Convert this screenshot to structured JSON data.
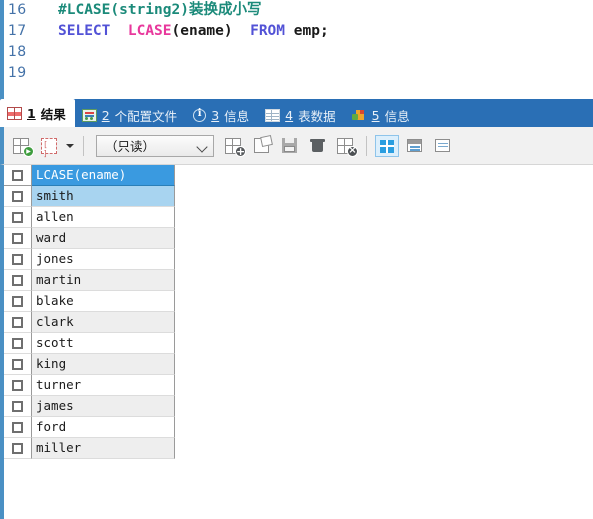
{
  "editor": {
    "lines": [
      {
        "number": "16",
        "tokens": [
          {
            "text": "#LCASE(string2)",
            "type": "comment"
          },
          {
            "text": "装换成小写",
            "type": "cjk"
          }
        ]
      },
      {
        "number": "17",
        "tokens": [
          {
            "text": "SELECT ",
            "type": "kw"
          },
          {
            "text": " LCASE",
            "type": "fn"
          },
          {
            "text": "(ename) ",
            "type": "plain"
          },
          {
            "text": " FROM ",
            "type": "kw"
          },
          {
            "text": "emp;",
            "type": "plain"
          }
        ]
      },
      {
        "number": "18",
        "tokens": []
      },
      {
        "number": "19",
        "tokens": []
      }
    ],
    "line_16_number": "16",
    "line_17_number": "17",
    "line_18_number": "18",
    "line_19_number": "19",
    "line_16_comment": "#LCASE(string2)",
    "line_16_cjk": "装换成小写",
    "kw_select": "SELECT",
    "fn_lcase": "LCASE",
    "arg_ename": "(ename)",
    "kw_from": "FROM",
    "tbl_emp": "emp;"
  },
  "tabs": [
    {
      "num": "1",
      "label": "结果",
      "icon": "results-grid-icon",
      "active": true
    },
    {
      "num": "2",
      "label": "个配置文件",
      "icon": "profile-icon",
      "active": false
    },
    {
      "num": "3",
      "label": "信息",
      "icon": "info-circle-icon",
      "active": false
    },
    {
      "num": "4",
      "label": "表数据",
      "icon": "table-grid-icon",
      "active": false
    },
    {
      "num": "5",
      "label": "信息",
      "icon": "status-blocks-icon",
      "active": false
    }
  ],
  "toolbar": {
    "buttons": [
      {
        "name": "apply-changes-button",
        "icon": "grid-play-icon"
      },
      {
        "name": "stop-button",
        "icon": "grid-red-icon"
      }
    ],
    "mode_select": {
      "value": "（只读）",
      "options": [
        "（只读）"
      ]
    },
    "actions": [
      {
        "name": "add-record-button",
        "icon": "grid-plus-icon"
      },
      {
        "name": "export-button",
        "icon": "export-icon"
      },
      {
        "name": "save-button",
        "icon": "floppy-save-icon"
      },
      {
        "name": "delete-button",
        "icon": "trash-icon"
      },
      {
        "name": "remove-record-button",
        "icon": "grid-x-icon"
      }
    ],
    "views": [
      {
        "name": "grid-view-button",
        "icon": "grid-view-icon",
        "active": true
      },
      {
        "name": "form-view-button",
        "icon": "form-view-icon",
        "active": false
      },
      {
        "name": "text-view-button",
        "icon": "text-view-icon",
        "active": false
      }
    ]
  },
  "result_grid": {
    "column_header": "LCASE(ename)",
    "selected_row_index": 0,
    "rows": [
      "smith",
      "allen",
      "ward",
      "jones",
      "martin",
      "blake",
      "clark",
      "scott",
      "king",
      "turner",
      "james",
      "ford",
      "miller"
    ]
  },
  "colors": {
    "tabbar_bg": "#2a6fb5",
    "accent_blue": "#4a90c4",
    "header_blue": "#3a9ae0",
    "selected_row": "#a8d4f0",
    "alt_row": "#eeeeee",
    "keyword": "#5252d6",
    "function": "#e8389c",
    "comment": "#1b8a7a",
    "gutter_text": "#4472a8"
  }
}
